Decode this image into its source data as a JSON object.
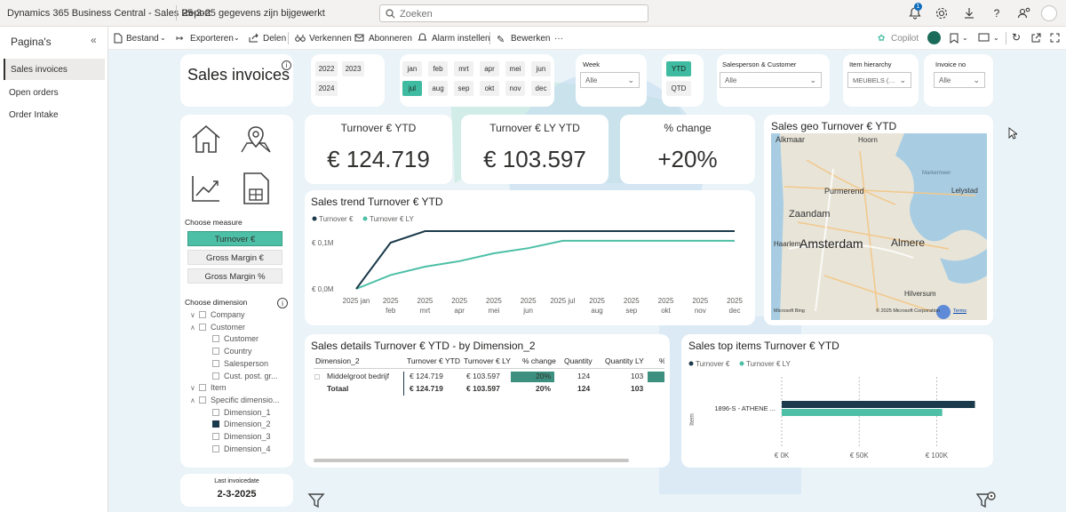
{
  "topbar": {
    "app_title": "Dynamics 365 Business Central - Sales Report",
    "update_status": "25-3-25 gegevens zijn bijgewerkt",
    "search_placeholder": "Zoeken",
    "notification_count": "1"
  },
  "sidebar": {
    "title": "Pagina's",
    "items": [
      {
        "label": "Sales invoices",
        "active": true
      },
      {
        "label": "Open orders",
        "active": false
      },
      {
        "label": "Order Intake",
        "active": false
      }
    ]
  },
  "toolbar": {
    "file": "Bestand",
    "export": "Exporteren",
    "share": "Delen",
    "explore": "Verkennen",
    "subscribe": "Abonneren",
    "alert": "Alarm instellen",
    "edit": "Bewerken",
    "more": "···",
    "copilot": "Copilot"
  },
  "report": {
    "title": "Sales invoices",
    "info_icon": "i",
    "years": [
      "2022",
      "2023",
      "2024"
    ],
    "months": [
      "jan",
      "feb",
      "mrt",
      "apr",
      "mei",
      "jun",
      "jul",
      "aug",
      "sep",
      "okt",
      "nov",
      "dec"
    ],
    "selected_month": "jul",
    "week": {
      "label": "Week",
      "value": "Alle"
    },
    "period": {
      "ytd": "YTD",
      "qtd": "QTD"
    },
    "salesperson": {
      "label": "Salesperson & Customer",
      "value": "Alle"
    },
    "item_hierarchy": {
      "label": "Item hierarchy",
      "value": "MEUBELS (…"
    },
    "invoice_no": {
      "label": "Invoice no",
      "value": "Alle"
    },
    "kpis": [
      {
        "title": "Turnover € YTD",
        "value": "€ 124.719"
      },
      {
        "title": "Turnover € LY YTD",
        "value": "€ 103.597"
      },
      {
        "title": "% change",
        "value": "+20%"
      }
    ],
    "choose_measure": "Choose measure",
    "measures": [
      "Turnover €",
      "Gross Margin €",
      "Gross Margin %"
    ],
    "choose_dimension": "Choose dimension",
    "dimension_tree": [
      {
        "label": "Company",
        "level": 0,
        "exp": "∨",
        "checked": false
      },
      {
        "label": "Customer",
        "level": 0,
        "exp": "∧",
        "checked": false
      },
      {
        "label": "Customer",
        "level": 1,
        "exp": "",
        "checked": false
      },
      {
        "label": "Country",
        "level": 1,
        "exp": "",
        "checked": false
      },
      {
        "label": "Salesperson",
        "level": 1,
        "exp": "",
        "checked": false
      },
      {
        "label": "Cust. post. gr...",
        "level": 1,
        "exp": "",
        "checked": false
      },
      {
        "label": "Item",
        "level": 0,
        "exp": "∨",
        "checked": false
      },
      {
        "label": "Specific dimensio...",
        "level": 0,
        "exp": "∧",
        "checked": false
      },
      {
        "label": "Dimension_1",
        "level": 1,
        "exp": "",
        "checked": false
      },
      {
        "label": "Dimension_2",
        "level": 1,
        "exp": "",
        "checked": true
      },
      {
        "label": "Dimension_3",
        "level": 1,
        "exp": "",
        "checked": false
      },
      {
        "label": "Dimension_4",
        "level": 1,
        "exp": "",
        "checked": false
      }
    ],
    "last_invoice_label": "Last invoicedate",
    "last_invoice_date": "2-3-2025",
    "map": {
      "title": "Sales geo Turnover € YTD",
      "place_labels": [
        "Alkmaar",
        "Hoorn",
        "Purmerend",
        "Zaandam",
        "Amsterdam",
        "Almere",
        "Lelystad",
        "Haarlem",
        "Hilversum",
        "Markermeer"
      ],
      "credit": "© 2025 Microsoft Corporation",
      "terms": "Terms",
      "logo": "Microsoft Bing"
    },
    "details": {
      "title": "Sales details Turnover € YTD - by Dimension_2",
      "columns": [
        "Dimension_2",
        "Turnover € YTD",
        "Turnover € LY",
        "% change",
        "Quantity",
        "Quantity LY",
        "% c"
      ],
      "rows": [
        {
          "name": "Middelgroot bedrijf",
          "turnover": "€ 124.719",
          "turnover_ly": "€ 103.597",
          "change": "20%",
          "qty": "124",
          "qty_ly": "103"
        }
      ],
      "total": {
        "name": "Totaal",
        "turnover": "€ 124.719",
        "turnover_ly": "€ 103.597",
        "change": "20%",
        "qty": "124",
        "qty_ly": "103"
      }
    }
  },
  "colors": {
    "navy": "#1b3a4b",
    "teal": "#4cbfa6",
    "background": "#e9f3f8"
  },
  "chart_data": [
    {
      "type": "line",
      "title": "Sales trend Turnover € YTD",
      "x": [
        "2025 jan",
        "2025 feb",
        "2025 mrt",
        "2025 apr",
        "2025 mei",
        "2025 jun",
        "2025 jul",
        "2025 aug",
        "2025 sep",
        "2025 okt",
        "2025 nov",
        "2025 dec"
      ],
      "tick_labels": [
        [
          "2025 jan"
        ],
        [
          "2025",
          "feb"
        ],
        [
          "2025",
          "mrt"
        ],
        [
          "2025",
          "apr"
        ],
        [
          "2025",
          "mei"
        ],
        [
          "2025",
          "jun"
        ],
        [
          "2025 jul"
        ],
        [
          "2025",
          "aug"
        ],
        [
          "2025",
          "sep"
        ],
        [
          "2025",
          "okt"
        ],
        [
          "2025",
          "nov"
        ],
        [
          "2025",
          "dec"
        ]
      ],
      "series": [
        {
          "name": "Turnover €",
          "color": "#1b3a4b",
          "values": [
            0,
            100000,
            125000,
            125000,
            125000,
            125000,
            125000,
            125000,
            125000,
            125000,
            125000,
            125000
          ]
        },
        {
          "name": "Turnover € LY",
          "color": "#4cbfa6",
          "values": [
            0,
            30000,
            48000,
            60000,
            77000,
            88000,
            104000,
            104000,
            104000,
            104000,
            104000,
            104000
          ]
        }
      ],
      "yticks": [
        0,
        100000
      ],
      "ytick_labels": [
        "€ 0,0M",
        "€ 0,1M"
      ],
      "ylim": [
        0,
        175000
      ],
      "legend": "top-left"
    },
    {
      "type": "bar",
      "orientation": "horizontal",
      "title": "Sales top items Turnover € YTD",
      "ylabel": "Item",
      "categories": [
        "1896-S - ATHENE ..."
      ],
      "series": [
        {
          "name": "Turnover €",
          "color": "#1b3a4b",
          "values": [
            124719
          ]
        },
        {
          "name": "Turnover € LY",
          "color": "#4cbfa6",
          "values": [
            103597
          ]
        }
      ],
      "xticks": [
        0,
        50000,
        100000
      ],
      "xtick_labels": [
        "€ 0K",
        "€ 50K",
        "€ 100K"
      ],
      "xlim": [
        0,
        125000
      ],
      "legend": "top-left"
    }
  ]
}
